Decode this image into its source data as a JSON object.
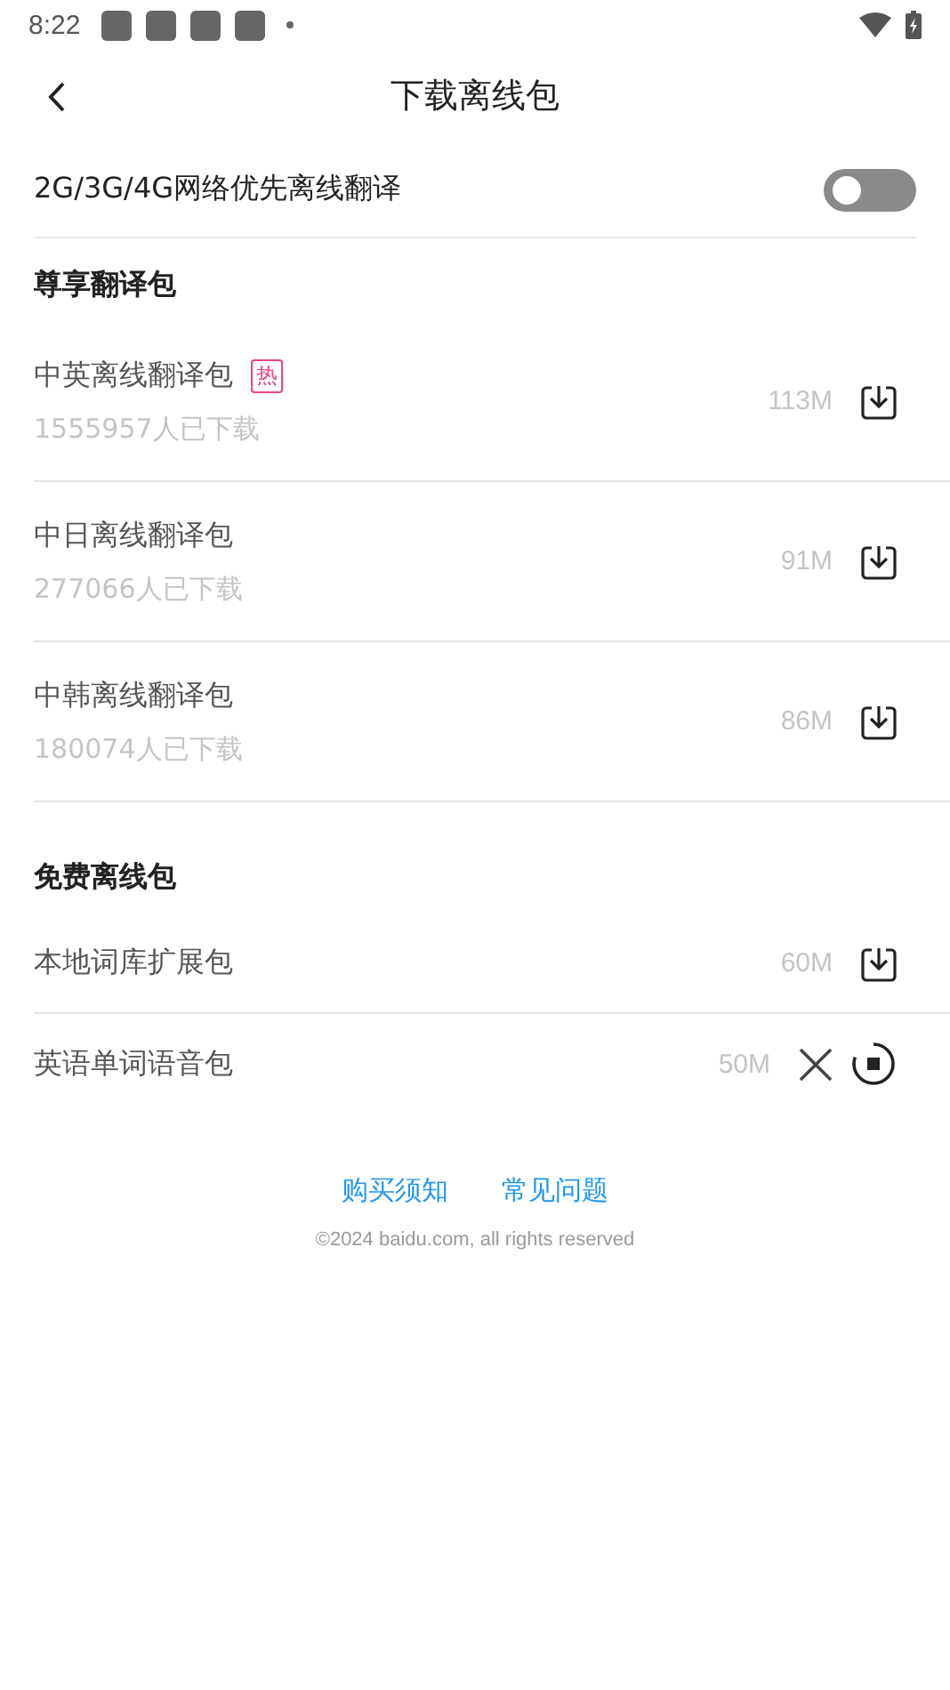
{
  "status_bar": {
    "time": "8:22",
    "notification_icons": [
      {
        "kind": "app"
      },
      {
        "kind": "app"
      },
      {
        "kind": "app"
      },
      {
        "kind": "app"
      },
      {
        "kind": "more"
      }
    ]
  },
  "header": {
    "title": "下载离线包"
  },
  "setting": {
    "label": "2G/3G/4G网络优先离线翻译",
    "on": false
  },
  "sections": [
    {
      "title": "尊享翻译包",
      "items": [
        {
          "name": "中英离线翻译包",
          "badge": "热",
          "downloads": "1555957人已下载",
          "size": "113M",
          "kind": "download"
        },
        {
          "name": "中日离线翻译包",
          "downloads": "277066人已下载",
          "size": "91M",
          "kind": "download"
        },
        {
          "name": "中韩离线翻译包",
          "downloads": "180074人已下载",
          "size": "86M",
          "kind": "download"
        }
      ]
    },
    {
      "title": "免费离线包",
      "items": [
        {
          "name": "本地词库扩展包",
          "size": "60M",
          "kind": "download"
        },
        {
          "name": "英语单词语音包",
          "size": "50M",
          "kind": "downloading",
          "level": 0.8
        }
      ]
    }
  ],
  "footer": {
    "links": [
      "购买须知",
      "常见问题"
    ],
    "copyright": "©2024 baidu.com, all rights reserved"
  }
}
